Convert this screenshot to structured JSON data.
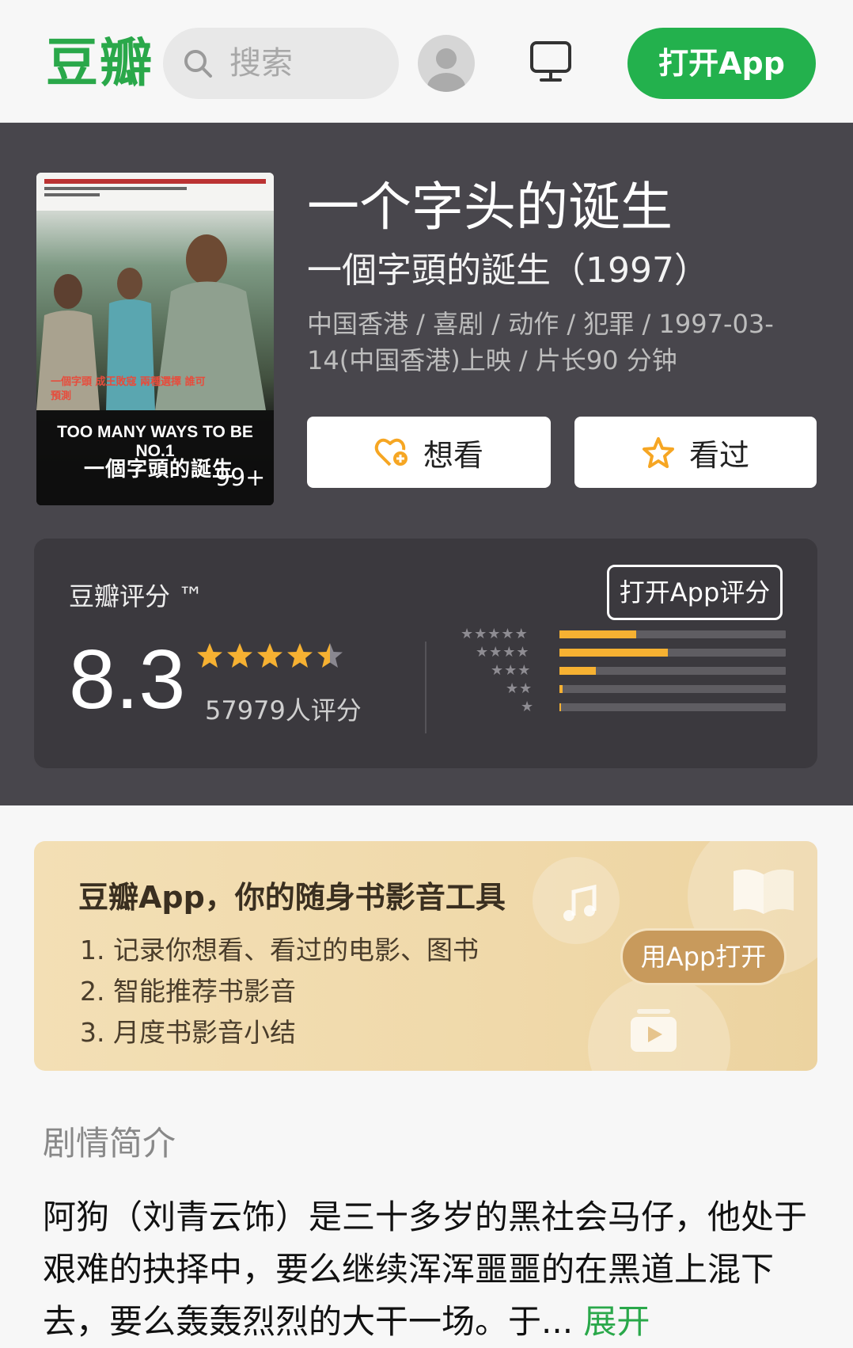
{
  "header": {
    "logo": "豆瓣",
    "search_placeholder": "搜索",
    "open_app": "打开App"
  },
  "movie": {
    "title": "一个字头的诞生",
    "original_title": "一個字頭的誕生（1997）",
    "meta": "中国香港 / 喜剧 / 动作 / 犯罪 / 1997-03-14(中国香港)上映 / 片长90 分钟",
    "poster": {
      "tagline": "一個字頭 成王敗寇 兩種選擇 誰可預測",
      "english_title": "TOO MANY WAYS TO BE NO.1",
      "chinese_title": "一個字頭的誕生",
      "count": "99+"
    },
    "want_label": "想看",
    "seen_label": "看过"
  },
  "rating": {
    "label": "豆瓣评分 ™",
    "open_app_rate": "打开App评分",
    "score": "8.3",
    "stars": 4.5,
    "votes": "57979人评分",
    "distribution": [
      {
        "stars": 5,
        "fraction": 0.34
      },
      {
        "stars": 4,
        "fraction": 0.48
      },
      {
        "stars": 3,
        "fraction": 0.16
      },
      {
        "stars": 2,
        "fraction": 0.015
      },
      {
        "stars": 1,
        "fraction": 0.005
      }
    ],
    "colors": {
      "star": "#f6b132",
      "track": "#5f5d62"
    }
  },
  "promo": {
    "title": "豆瓣App，你的随身书影音工具",
    "items": [
      "1. 记录你想看、看过的电影、图书",
      "2. 智能推荐书影音",
      "3. 月度书影音小结"
    ],
    "button": "用App打开",
    "icons": [
      "music-note-icon",
      "book-icon",
      "video-icon"
    ]
  },
  "synopsis": {
    "heading": "剧情简介",
    "text": "阿狗（刘青云饰）是三十多岁的黑社会马仔，他处于艰难的抉择中，要么继续浑浑噩噩的在黑道上混下去，要么轰轰烈烈的大干一场。于...",
    "more": "展开"
  },
  "theme": {
    "brand_green": "#2aa84a",
    "hero_bg": "#48464c"
  }
}
